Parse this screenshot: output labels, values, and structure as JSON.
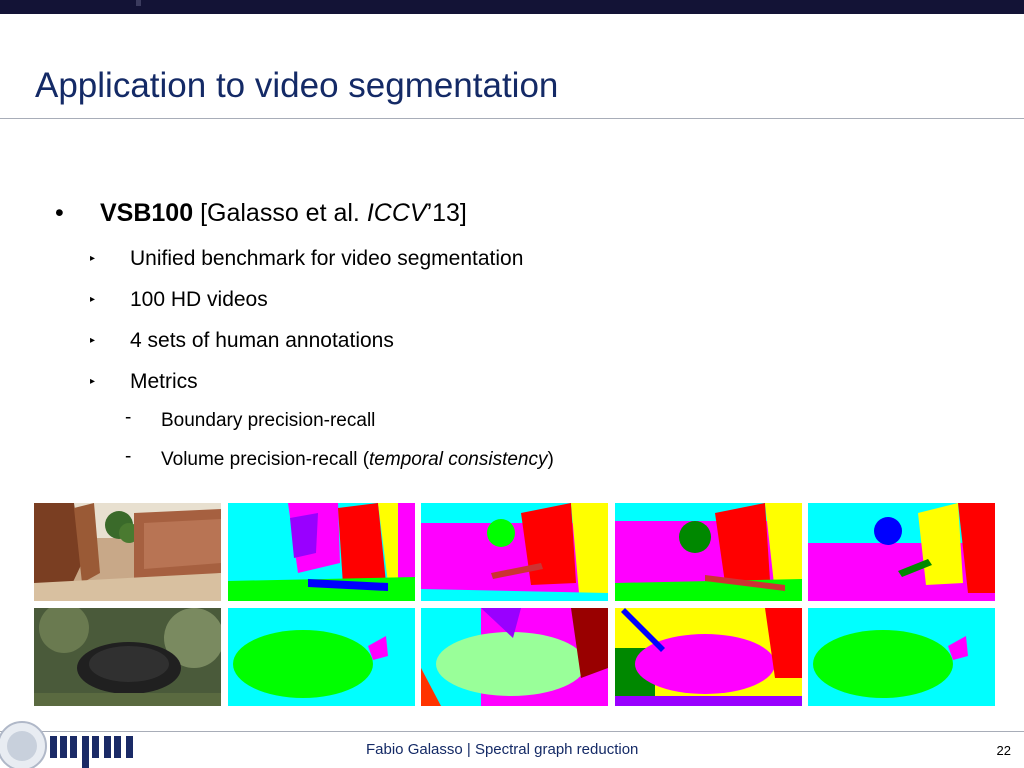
{
  "title": "Application to video segmentation",
  "bullet": {
    "marker": "•",
    "name": "VSB100",
    "ref_pre": "[Galasso et al. ",
    "ref_venue": "ICCV",
    "ref_post": "’13]"
  },
  "sub_items": [
    "Unified benchmark for video segmentation",
    "100 HD videos",
    "4 sets of human annotations",
    "Metrics"
  ],
  "metric_items": {
    "boundary": "Boundary precision-recall",
    "volume_pre": "Volume precision-recall (",
    "volume_em": "temporal consistency",
    "volume_post": ")"
  },
  "markers": {
    "arrow": "▸",
    "dash": "-"
  },
  "images": {
    "row1": [
      "temple-photo",
      "temple-annotation-1",
      "temple-annotation-2",
      "temple-annotation-3",
      "temple-annotation-4"
    ],
    "row2": [
      "bird-photo",
      "bird-annotation-1",
      "bird-annotation-2",
      "bird-annotation-3",
      "bird-annotation-4"
    ]
  },
  "colors": {
    "title": "#142a66",
    "top_bar": "#131336",
    "segment_cyan": "#00ffff",
    "segment_magenta": "#ff00ff",
    "segment_red": "#ff0000",
    "segment_yellow": "#ffff00",
    "segment_green": "#00ff00",
    "segment_blue": "#0000ff"
  },
  "footer": {
    "author": "Fabio Galasso",
    "separator": " | ",
    "talk": "Spectral graph reduction",
    "page": "22"
  }
}
